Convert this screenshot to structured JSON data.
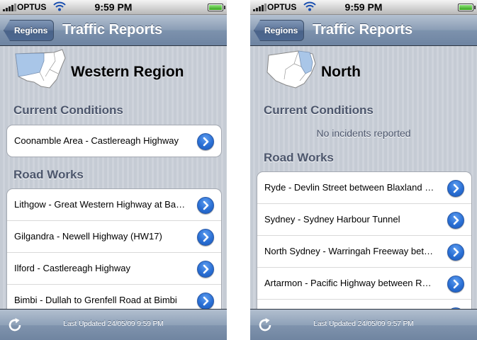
{
  "screens": [
    {
      "status": {
        "carrier": "OPTUS",
        "time": "9:59 PM"
      },
      "nav": {
        "back_label": "Regions",
        "title": "Traffic Reports"
      },
      "region": {
        "name": "Western Region"
      },
      "current_conditions": {
        "heading": "Current Conditions",
        "message": "",
        "items": [
          "Coonamble Area - Castlereagh Highway"
        ]
      },
      "road_works": {
        "heading": "Road Works",
        "items": [
          "Lithgow - Great Western Highway  at Bathurst",
          "Gilgandra - Newell Highway (HW17)",
          "Ilford - Castlereagh Highway",
          "Bimbi - Dullah to Grenfell Road  at Bimbi"
        ]
      },
      "toolbar": {
        "updated": "Last Updated 24/05/09 9:59 PM"
      }
    },
    {
      "status": {
        "carrier": "OPTUS",
        "time": "9:59 PM"
      },
      "nav": {
        "back_label": "Regions",
        "title": "Traffic Reports"
      },
      "region": {
        "name": "North"
      },
      "current_conditions": {
        "heading": "Current Conditions",
        "message": "No incidents reported",
        "items": []
      },
      "road_works": {
        "heading": "Road Works",
        "items": [
          "Ryde - Devlin Street  between Blaxland Road",
          "Sydney - Sydney Harbour Tunnel",
          "North Sydney - Warringah Freeway  between",
          "Artarmon - Pacific Highway  between Reserve",
          ""
        ]
      },
      "toolbar": {
        "updated": "Last Updated 24/05/09 9:57 PM"
      }
    }
  ],
  "colors": {
    "highlight_region": "#a9c6e8",
    "map_fill": "#ffffff",
    "disclosure_blue": "#2a6fd4",
    "section_heading": "#4c566c",
    "navbar": "#7d92ad"
  },
  "icons": {
    "signal": "signal-bars-icon",
    "wifi": "wifi-icon",
    "battery": "battery-icon",
    "map": "nsw-region-map-icon",
    "disclosure": "chevron-right-circle-icon",
    "refresh": "refresh-icon"
  }
}
